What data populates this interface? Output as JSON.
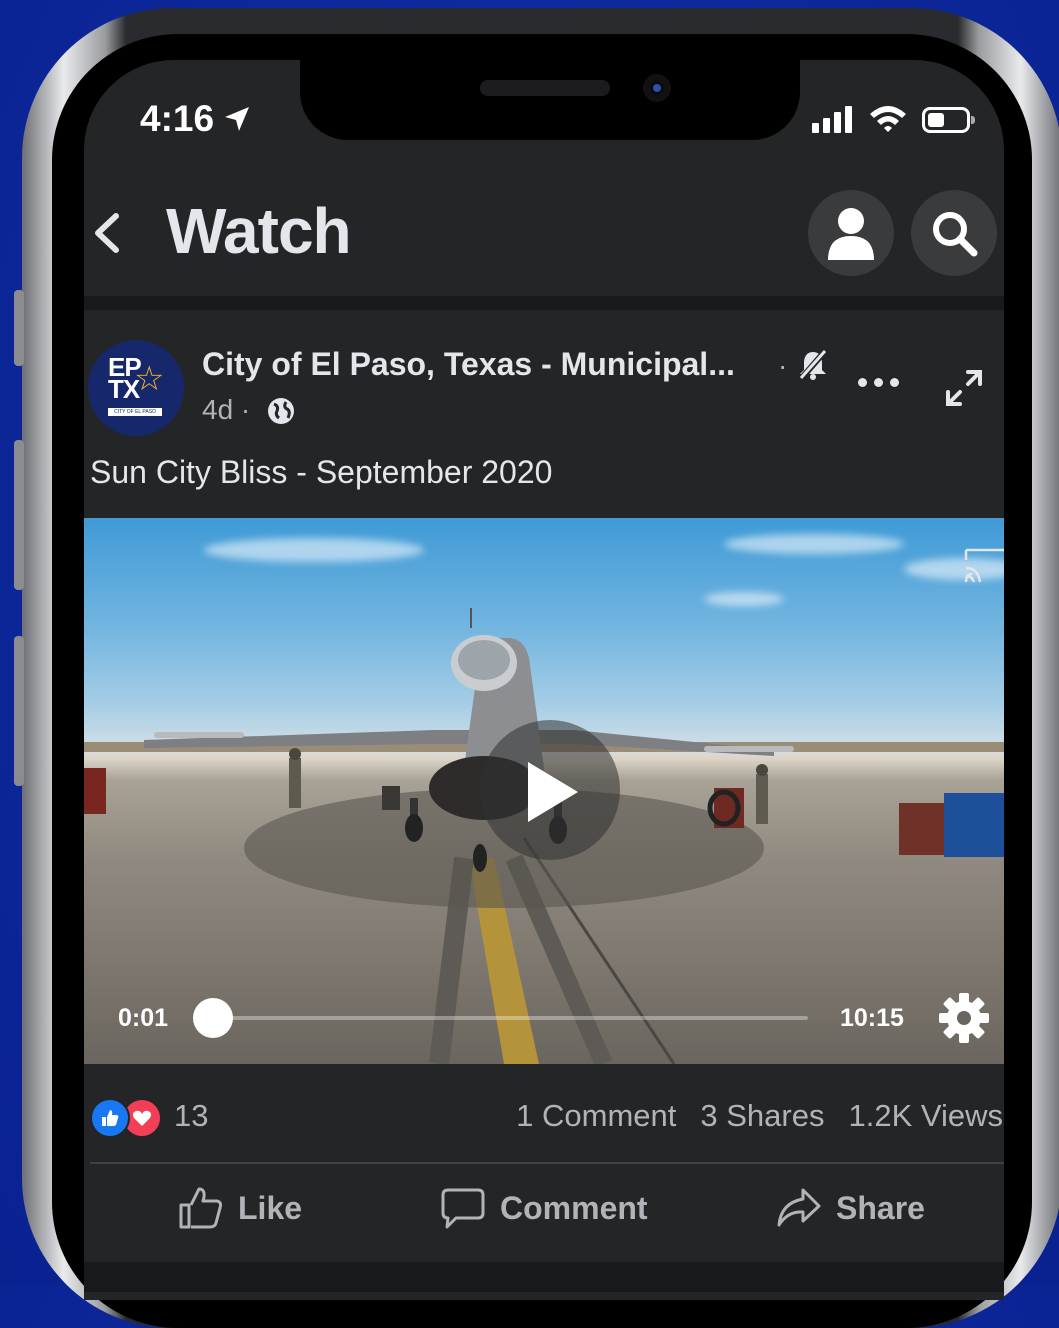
{
  "status_bar": {
    "time": "4:16"
  },
  "header": {
    "title": "Watch"
  },
  "post": {
    "page_name": "City of El Paso, Texas - Municipal...",
    "meta_sep": "·",
    "age": "4d ·",
    "text": "Sun City Bliss - September 2020",
    "avatar": {
      "line1": "EP",
      "line2": "TX",
      "sub": "CITY OF EL PASO"
    }
  },
  "video": {
    "current_time": "0:01",
    "duration": "10:15",
    "progress_fraction": 0.0016
  },
  "engagement": {
    "reaction_count": "13",
    "comments": "1 Comment",
    "shares": "3 Shares",
    "views": "1.2K Views"
  },
  "actions": {
    "like": "Like",
    "comment": "Comment",
    "share": "Share"
  },
  "colors": {
    "background_blue": "#0d2a9e",
    "surface": "#242526",
    "like_blue": "#1877f2",
    "love_red": "#f33e58"
  },
  "icons": [
    "location-arrow-icon",
    "signal-icon",
    "wifi-icon",
    "battery-icon",
    "back-chevron-icon",
    "profile-icon",
    "search-icon",
    "bell-off-icon",
    "globe-icon",
    "more-icon",
    "expand-icon",
    "cast-icon",
    "play-icon",
    "gear-icon",
    "like-icon",
    "comment-icon",
    "share-icon"
  ]
}
